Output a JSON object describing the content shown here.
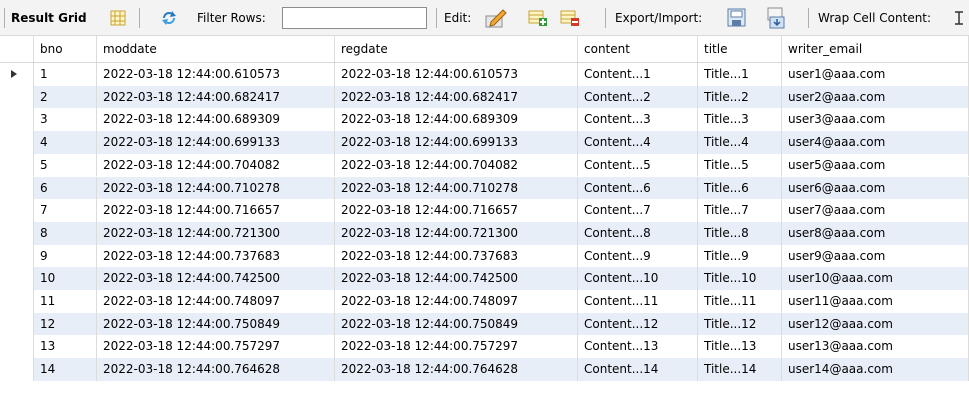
{
  "toolbar": {
    "result_grid_label": "Result Grid",
    "filter_rows_label": "Filter Rows:",
    "filter_value": "",
    "edit_label": "Edit:",
    "export_import_label": "Export/Import:",
    "wrap_cell_label": "Wrap Cell Content:"
  },
  "grid": {
    "columns": [
      "bno",
      "moddate",
      "regdate",
      "content",
      "title",
      "writer_email"
    ],
    "rows": [
      [
        "1",
        "2022-03-18 12:44:00.610573",
        "2022-03-18 12:44:00.610573",
        "Content...1",
        "Title...1",
        "user1@aaa.com"
      ],
      [
        "2",
        "2022-03-18 12:44:00.682417",
        "2022-03-18 12:44:00.682417",
        "Content...2",
        "Title...2",
        "user2@aaa.com"
      ],
      [
        "3",
        "2022-03-18 12:44:00.689309",
        "2022-03-18 12:44:00.689309",
        "Content...3",
        "Title...3",
        "user3@aaa.com"
      ],
      [
        "4",
        "2022-03-18 12:44:00.699133",
        "2022-03-18 12:44:00.699133",
        "Content...4",
        "Title...4",
        "user4@aaa.com"
      ],
      [
        "5",
        "2022-03-18 12:44:00.704082",
        "2022-03-18 12:44:00.704082",
        "Content...5",
        "Title...5",
        "user5@aaa.com"
      ],
      [
        "6",
        "2022-03-18 12:44:00.710278",
        "2022-03-18 12:44:00.710278",
        "Content...6",
        "Title...6",
        "user6@aaa.com"
      ],
      [
        "7",
        "2022-03-18 12:44:00.716657",
        "2022-03-18 12:44:00.716657",
        "Content...7",
        "Title...7",
        "user7@aaa.com"
      ],
      [
        "8",
        "2022-03-18 12:44:00.721300",
        "2022-03-18 12:44:00.721300",
        "Content...8",
        "Title...8",
        "user8@aaa.com"
      ],
      [
        "9",
        "2022-03-18 12:44:00.737683",
        "2022-03-18 12:44:00.737683",
        "Content...9",
        "Title...9",
        "user9@aaa.com"
      ],
      [
        "10",
        "2022-03-18 12:44:00.742500",
        "2022-03-18 12:44:00.742500",
        "Content...10",
        "Title...10",
        "user10@aaa.com"
      ],
      [
        "11",
        "2022-03-18 12:44:00.748097",
        "2022-03-18 12:44:00.748097",
        "Content...11",
        "Title...11",
        "user11@aaa.com"
      ],
      [
        "12",
        "2022-03-18 12:44:00.750849",
        "2022-03-18 12:44:00.750849",
        "Content...12",
        "Title...12",
        "user12@aaa.com"
      ],
      [
        "13",
        "2022-03-18 12:44:00.757297",
        "2022-03-18 12:44:00.757297",
        "Content...13",
        "Title...13",
        "user13@aaa.com"
      ],
      [
        "14",
        "2022-03-18 12:44:00.764628",
        "2022-03-18 12:44:00.764628",
        "Content...14",
        "Title...14",
        "user14@aaa.com"
      ]
    ],
    "selected_row": 0
  },
  "colors": {
    "row_alt": "#e8eef8",
    "toolbar_bg": "#f3f3f3"
  },
  "icons": [
    "grid-view-icon",
    "refresh-icon",
    "edit-row-icon",
    "add-row-icon",
    "delete-row-icon",
    "export-icon",
    "import-icon",
    "wrap-cell-icon"
  ]
}
